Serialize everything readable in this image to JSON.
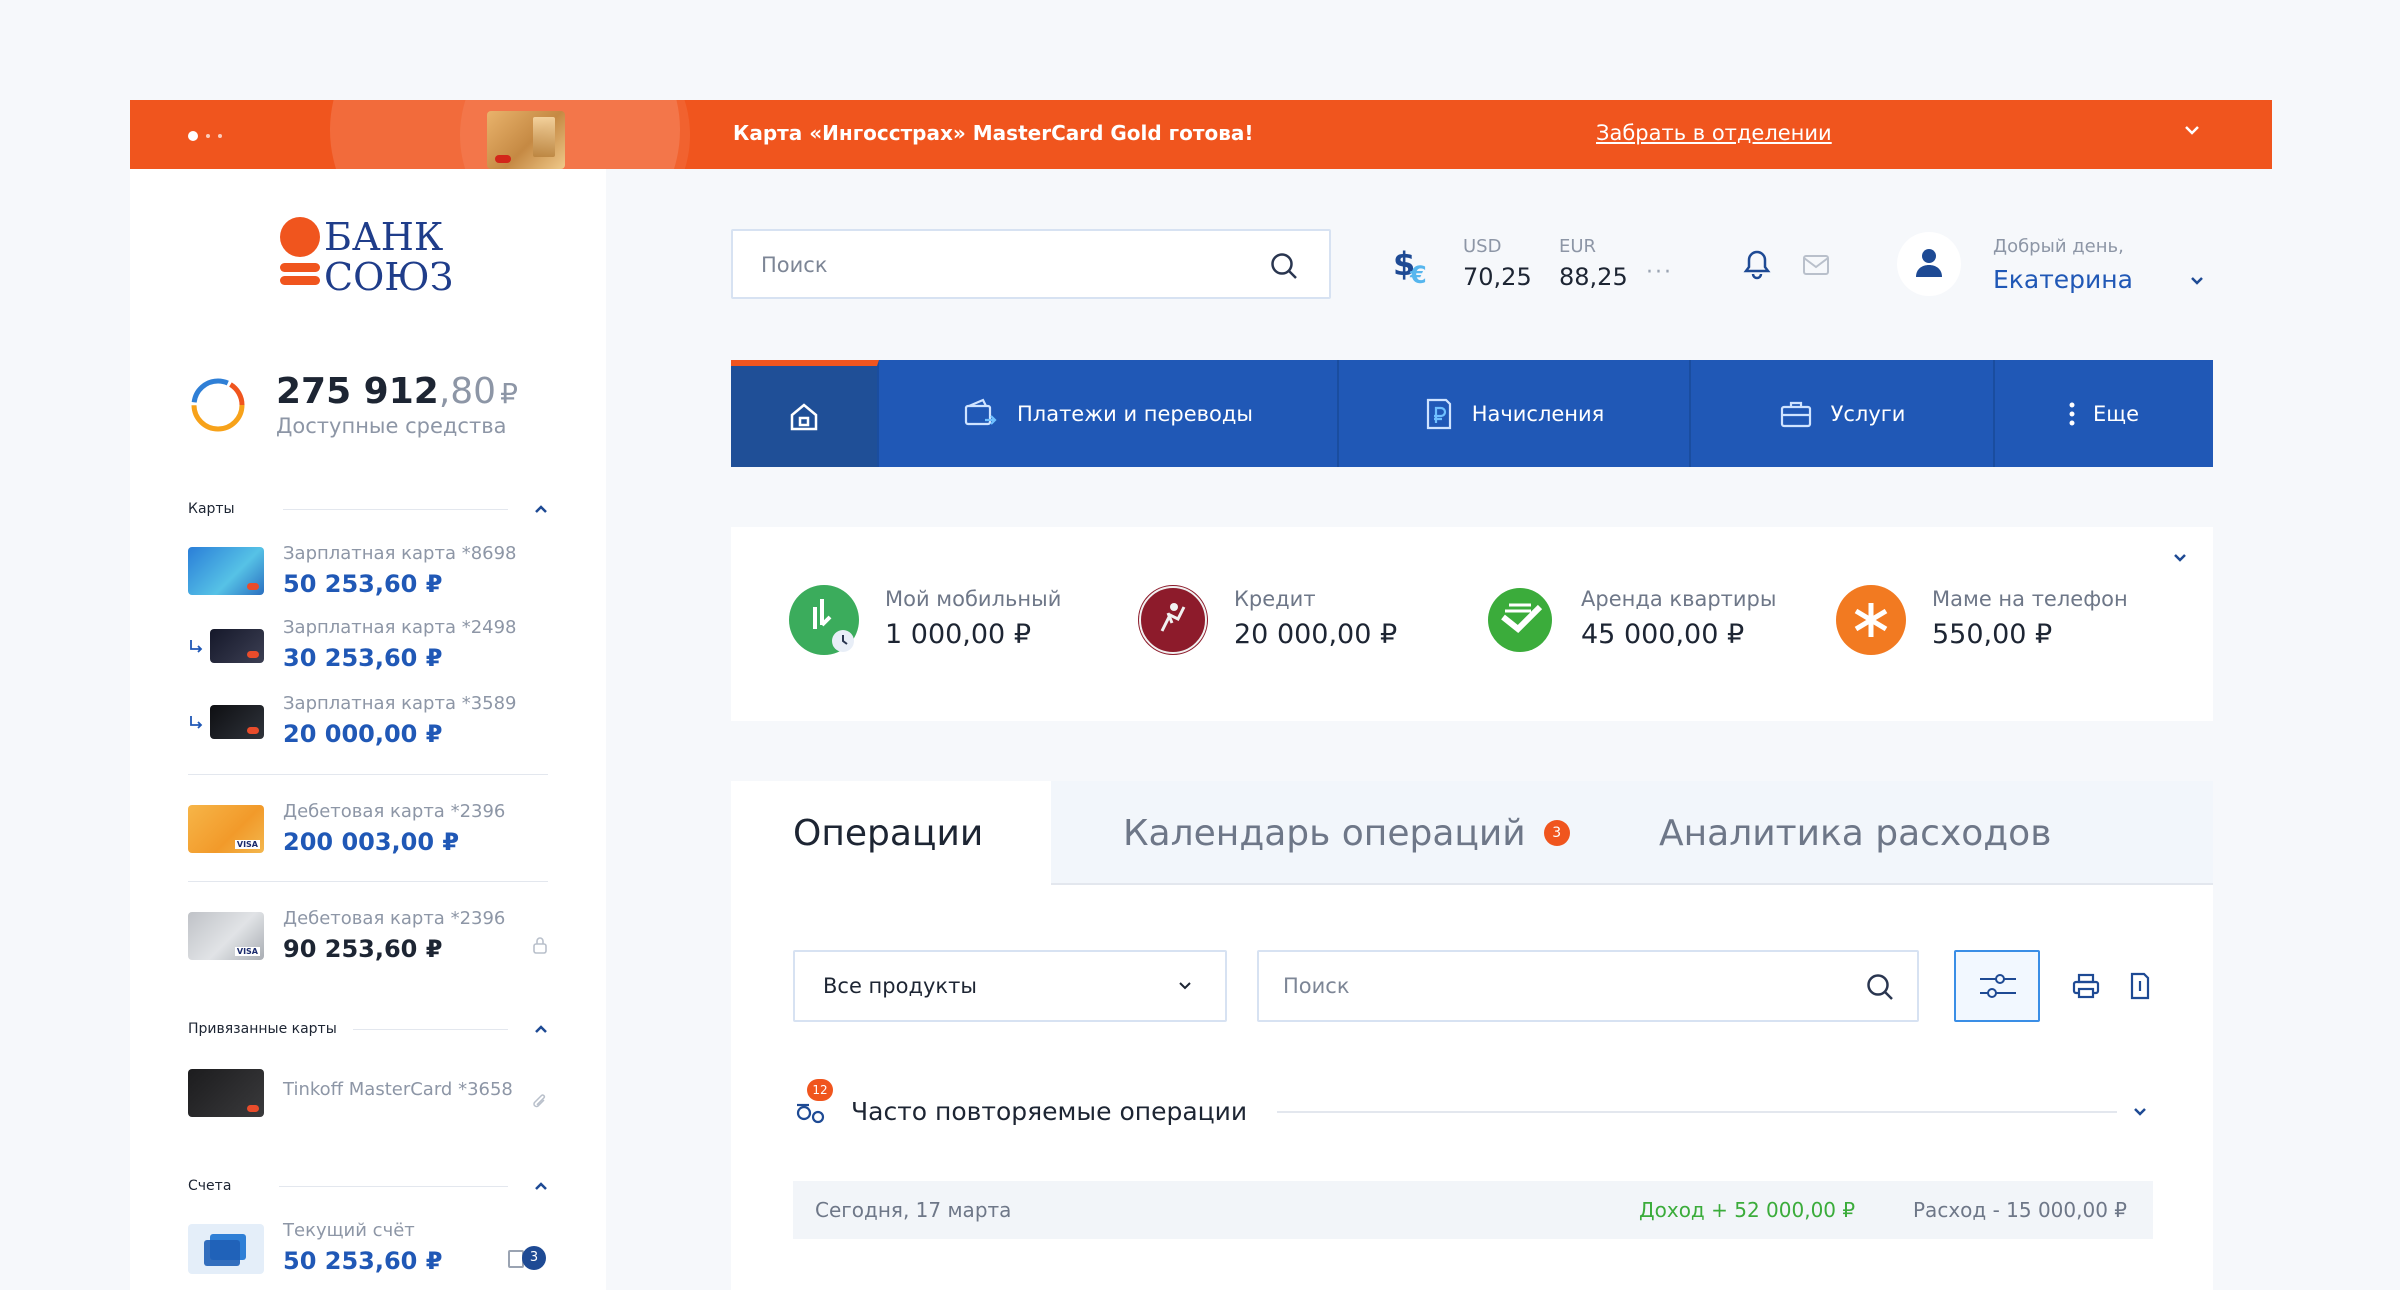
{
  "banner": {
    "text": "Карта «Ингосстрах» MasterCard Gold готова!",
    "link": "Забрать в отделении",
    "accent": "#f0551e"
  },
  "logo": {
    "line1": "БАНК",
    "line2": "СОЮЗ"
  },
  "balance": {
    "int": "275 912",
    "cents": ",80",
    "currency": "₽",
    "label": "Доступные средства"
  },
  "sidebar": {
    "cards_title": "Карты",
    "cards": [
      {
        "name": "Зарплатная карта *8698",
        "amount": "50 253,60 ₽"
      },
      {
        "name": "Зарплатная карта *2498",
        "amount": "30 253,60 ₽"
      },
      {
        "name": "Зарплатная карта *3589",
        "amount": "20 000,00 ₽"
      },
      {
        "name": "Дебетовая карта *2396",
        "amount": "200 003,00 ₽"
      },
      {
        "name": "Дебетовая карта *2396",
        "amount": "90 253,60 ₽"
      }
    ],
    "linked_title": "Привязанные карты",
    "linked": [
      {
        "name": "Tinkoff MasterCard *3658"
      }
    ],
    "accounts_title": "Счета",
    "accounts": [
      {
        "name": "Текущий счёт",
        "amount": "50 253,60 ₽",
        "badge": "3"
      }
    ]
  },
  "topbar": {
    "search_placeholder": "Поиск",
    "usd_label": "USD",
    "usd_value": "70,25",
    "eur_label": "EUR",
    "eur_value": "88,25",
    "more": "···",
    "greeting": "Добрый день,",
    "user": "Екатерина"
  },
  "nav": {
    "payments": "Платежи и переводы",
    "charges": "Начисления",
    "services": "Услуги",
    "more": "Еще"
  },
  "favorites": [
    {
      "label": "Мой мобильный",
      "amount": "1 000,00 ₽"
    },
    {
      "label": "Кредит",
      "amount": "20 000,00 ₽"
    },
    {
      "label": "Аренда квартиры",
      "amount": "45 000,00 ₽"
    },
    {
      "label": "Маме на телефон",
      "amount": "550,00 ₽"
    }
  ],
  "ops": {
    "tab1": "Операции",
    "tab2": "Календарь операций",
    "tab2_badge": "3",
    "tab3": "Аналитика расходов",
    "product_select": "Все продукты",
    "search_placeholder": "Поиск",
    "frequent": "Часто повторяемые операции",
    "frequent_badge": "12",
    "day": "Сегодня, 17 марта",
    "income": "Доход + 52 000,00 ₽",
    "expense": "Расход - 15 000,00 ₽"
  }
}
